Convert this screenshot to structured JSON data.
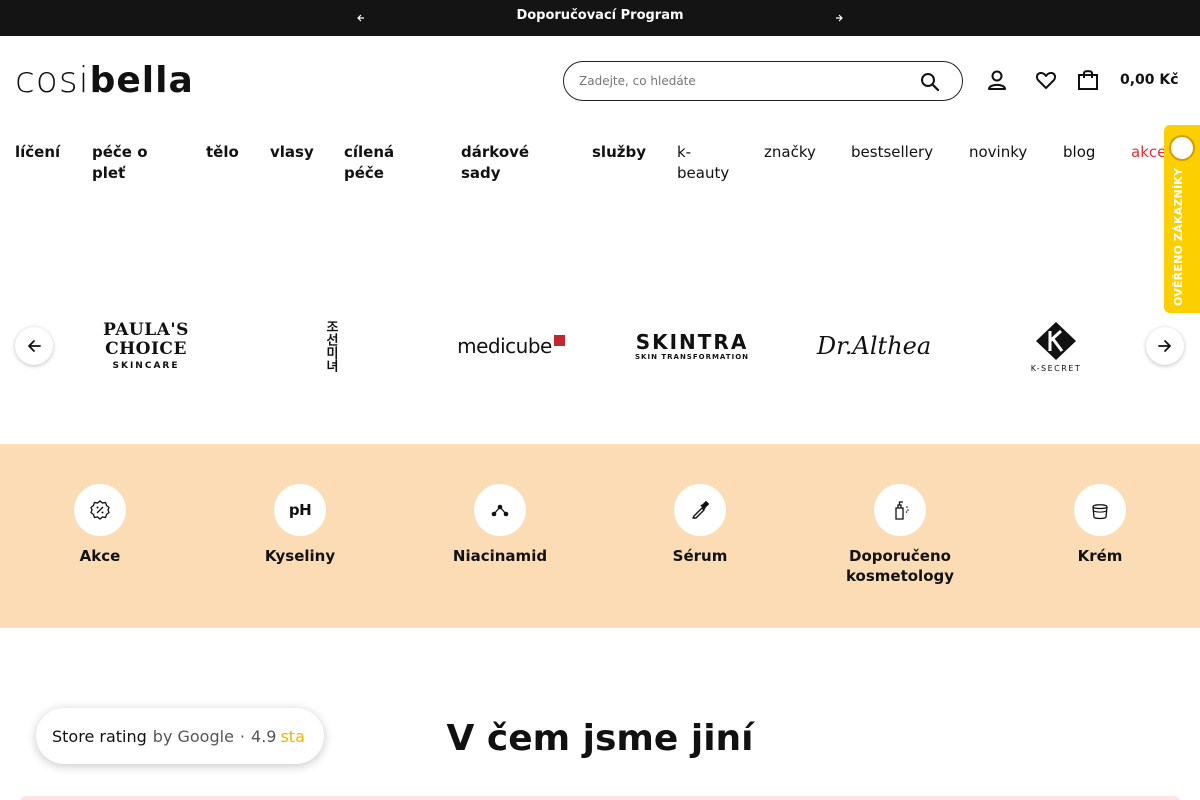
{
  "topbar": {
    "promo_text": "Doporučovací Program"
  },
  "header": {
    "logo_light": "cosi",
    "logo_bold": "bella",
    "search_placeholder": "Zadejte, co hledáte",
    "cart_total": "0,00 Kč"
  },
  "nav": [
    {
      "label": "líčení",
      "bold": true
    },
    {
      "label": "péče o pleť",
      "bold": true
    },
    {
      "label": "tělo",
      "bold": true
    },
    {
      "label": "vlasy",
      "bold": true
    },
    {
      "label": "cílená péče",
      "bold": true
    },
    {
      "label": "dárkové sady",
      "bold": true
    },
    {
      "label": "služby",
      "bold": true
    },
    {
      "label": "k-beauty",
      "bold": false
    },
    {
      "label": "značky",
      "bold": false
    },
    {
      "label": "bestsellery",
      "bold": false
    },
    {
      "label": "novinky",
      "bold": false
    },
    {
      "label": "blog",
      "bold": false
    },
    {
      "label": "akce",
      "bold": false
    }
  ],
  "verified_badge": {
    "text": "OVĚŘENO ZÁKAZNÍKY"
  },
  "brands": [
    {
      "name": "PAULA'S CHOICE",
      "sub": "SKINCARE"
    },
    {
      "name": "조선미녀"
    },
    {
      "name": "medicube"
    },
    {
      "name": "SKINTRA",
      "sub": "SKIN TRANSFORMATION"
    },
    {
      "name": "Dr.Althea"
    },
    {
      "name": "K-SECRET"
    }
  ],
  "categories": [
    {
      "label": "Akce",
      "icon": "discount-badge-icon"
    },
    {
      "label": "Kyseliny",
      "icon": "ph-icon"
    },
    {
      "label": "Niacinamid",
      "icon": "molecule-icon"
    },
    {
      "label": "Sérum",
      "icon": "dropper-icon"
    },
    {
      "label": "Doporučeno kosmetology",
      "icon": "pump-bottle-icon"
    },
    {
      "label": "Krém",
      "icon": "cream-jar-icon"
    }
  ],
  "rating": {
    "store": "Store rating",
    "by": "by Google",
    "score": "4.9",
    "stars_text": "sta"
  },
  "section": {
    "headline": "V čem jsme jiní"
  },
  "colors": {
    "topbar": "#141414",
    "band": "#fcdcb4",
    "sale": "#e1303c",
    "badge": "#fcd000"
  }
}
